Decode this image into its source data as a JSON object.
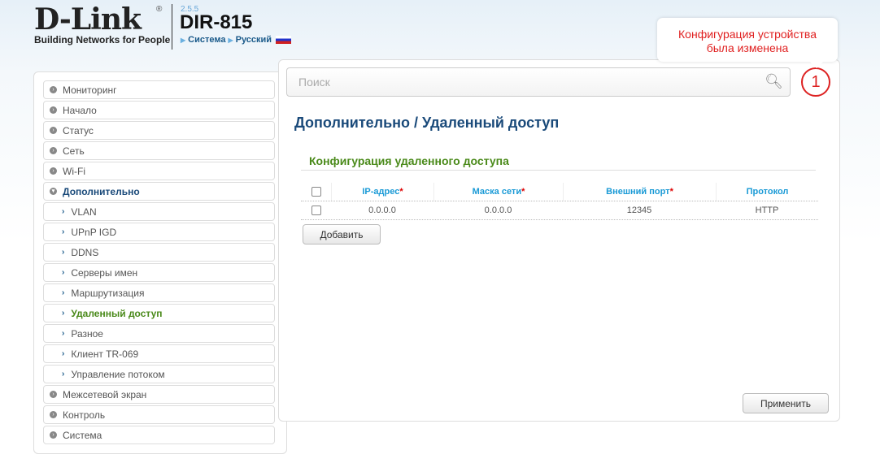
{
  "header": {
    "brand": "D-Link",
    "registered": "®",
    "tagline": "Building Networks for People",
    "version": "2.5.5",
    "model": "DIR-815",
    "crumb_system": "Система",
    "crumb_language": "Русский"
  },
  "notification": {
    "message_line1": "Конфигурация устройства",
    "message_line2": "была изменена",
    "count": "1"
  },
  "search": {
    "placeholder": "Поиск"
  },
  "sidebar": {
    "items": [
      {
        "label": "Мониторинг"
      },
      {
        "label": "Начало"
      },
      {
        "label": "Статус"
      },
      {
        "label": "Сеть"
      },
      {
        "label": "Wi-Fi"
      },
      {
        "label": "Дополнительно"
      },
      {
        "label": "VLAN"
      },
      {
        "label": "UPnP IGD"
      },
      {
        "label": "DDNS"
      },
      {
        "label": "Серверы имен"
      },
      {
        "label": "Маршрутизация"
      },
      {
        "label": "Удаленный доступ"
      },
      {
        "label": "Разное"
      },
      {
        "label": "Клиент TR-069"
      },
      {
        "label": "Управление потоком"
      },
      {
        "label": "Межсетевой экран"
      },
      {
        "label": "Контроль"
      },
      {
        "label": "Система"
      }
    ]
  },
  "main": {
    "title": "Дополнительно /  Удаленный доступ",
    "section_title": "Конфигурация удаленного доступа",
    "table": {
      "headers": [
        "IP-адрес",
        "Маска сети",
        "Внешний порт",
        "Протокол"
      ],
      "required_mark": "*",
      "rows": [
        {
          "ip": "0.0.0.0",
          "mask": "0.0.0.0",
          "port": "12345",
          "protocol": "HTTP"
        }
      ]
    },
    "add_label": "Добавить",
    "apply_label": "Применить"
  },
  "colors": {
    "accent": "#1a4a7a",
    "active": "#4a8a1a",
    "alert": "#e02020",
    "header_cell": "#1a9ad6"
  }
}
